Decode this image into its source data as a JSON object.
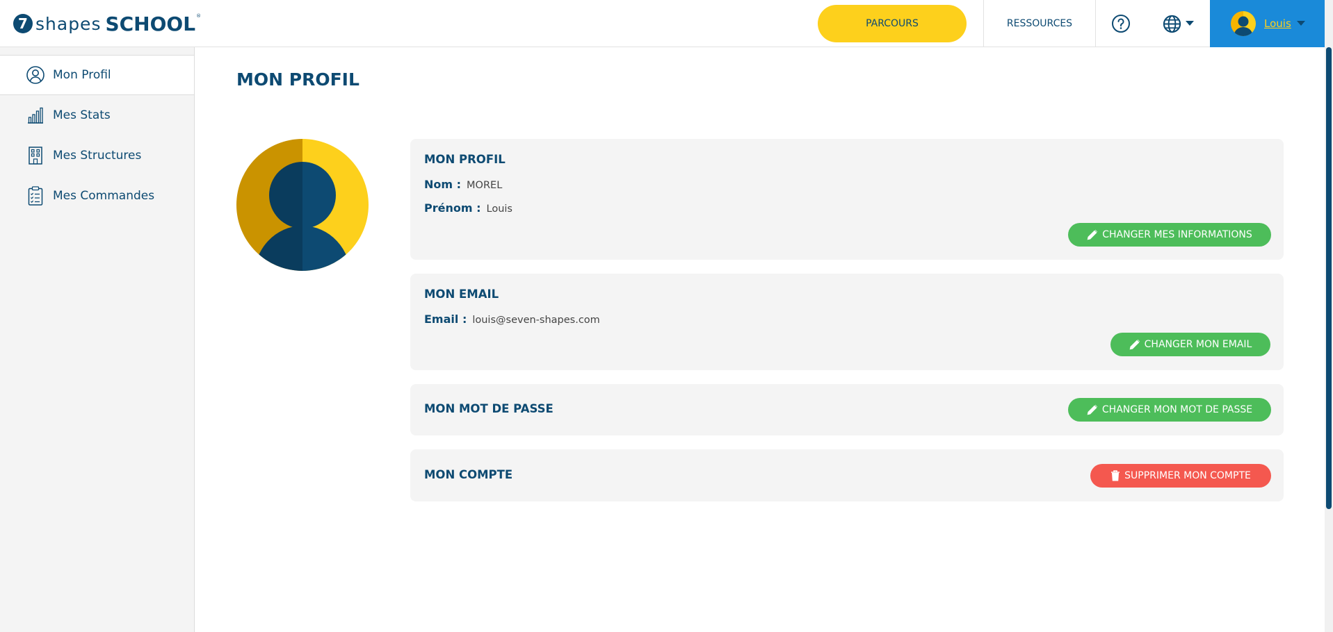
{
  "header": {
    "logo": {
      "number": "7",
      "shapes": "shapes",
      "school": "SCHOOL",
      "reg": "®"
    },
    "parcours_label": "PARCOURS",
    "ressources_label": "RESSOURCES",
    "user_name": "Louis"
  },
  "sidebar": {
    "items": [
      {
        "label": "Mon Profil",
        "icon": "user-circle-icon",
        "active": true
      },
      {
        "label": "Mes Stats",
        "icon": "bar-chart-icon",
        "active": false
      },
      {
        "label": "Mes Structures",
        "icon": "building-icon",
        "active": false
      },
      {
        "label": "Mes Commandes",
        "icon": "clipboard-list-icon",
        "active": false
      }
    ]
  },
  "main": {
    "title": "MON PROFIL",
    "profile_card": {
      "title": "MON PROFIL",
      "nom_label": "Nom :",
      "nom_value": "MOREL",
      "prenom_label": "Prénom :",
      "prenom_value": "Louis",
      "button": "CHANGER MES INFORMATIONS"
    },
    "email_card": {
      "title": "MON EMAIL",
      "email_label": "Email :",
      "email_value": "louis@seven-shapes.com",
      "button": "CHANGER MON EMAIL"
    },
    "password_card": {
      "title": "MON MOT DE PASSE",
      "button": "CHANGER MON MOT DE PASSE"
    },
    "account_card": {
      "title": "MON COMPTE",
      "button": "SUPPRIMER MON COMPTE"
    }
  },
  "colors": {
    "primary": "#0d4a72",
    "yellow": "#fdd01c",
    "user_bg": "#1a8ad9",
    "green": "#4dbd5a",
    "red": "#f4584f",
    "card_bg": "#f4f4f4"
  }
}
